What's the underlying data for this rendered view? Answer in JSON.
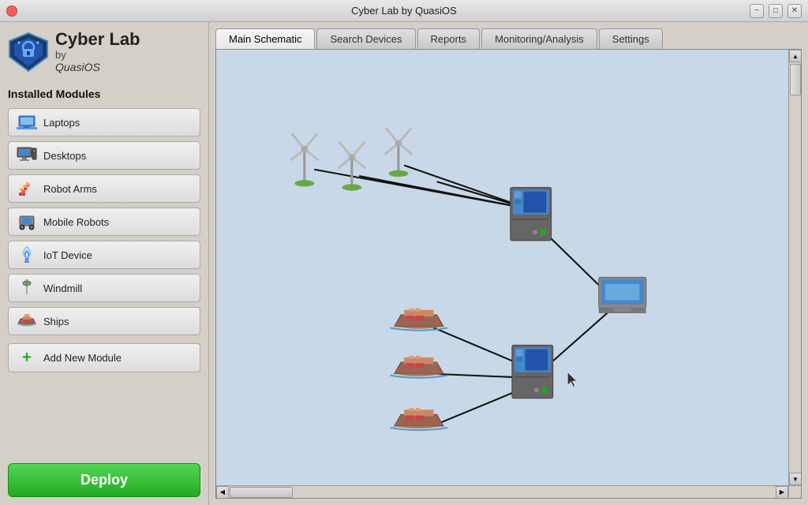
{
  "window": {
    "title": "Cyber Lab by QuasiOS"
  },
  "sidebar": {
    "logo_line1": "Cyber Lab",
    "logo_line2": "by",
    "logo_line3": "QuasiOS",
    "section_title": "Installed Modules",
    "modules": [
      {
        "id": "laptops",
        "label": "Laptops",
        "icon": "laptop-icon"
      },
      {
        "id": "desktops",
        "label": "Desktops",
        "icon": "desktop-icon"
      },
      {
        "id": "robot-arms",
        "label": "Robot Arms",
        "icon": "robot-arm-icon"
      },
      {
        "id": "mobile-robots",
        "label": "Mobile Robots",
        "icon": "mobile-robot-icon"
      },
      {
        "id": "iot-device",
        "label": "IoT Device",
        "icon": "iot-icon"
      },
      {
        "id": "windmill",
        "label": "Windmill",
        "icon": "windmill-icon"
      },
      {
        "id": "ships",
        "label": "Ships",
        "icon": "ship-icon"
      }
    ],
    "add_module_label": "Add New Module",
    "deploy_label": "Deploy"
  },
  "tabs": [
    {
      "id": "main-schematic",
      "label": "Main Schematic",
      "active": true
    },
    {
      "id": "search-devices",
      "label": "Search Devices",
      "active": false
    },
    {
      "id": "reports",
      "label": "Reports",
      "active": false
    },
    {
      "id": "monitoring",
      "label": "Monitoring/Analysis",
      "active": false
    },
    {
      "id": "settings",
      "label": "Settings",
      "active": false
    }
  ],
  "colors": {
    "canvas_bg": "#c8d8e8",
    "deploy_green": "#22aa22",
    "deploy_green_light": "#55d655"
  }
}
